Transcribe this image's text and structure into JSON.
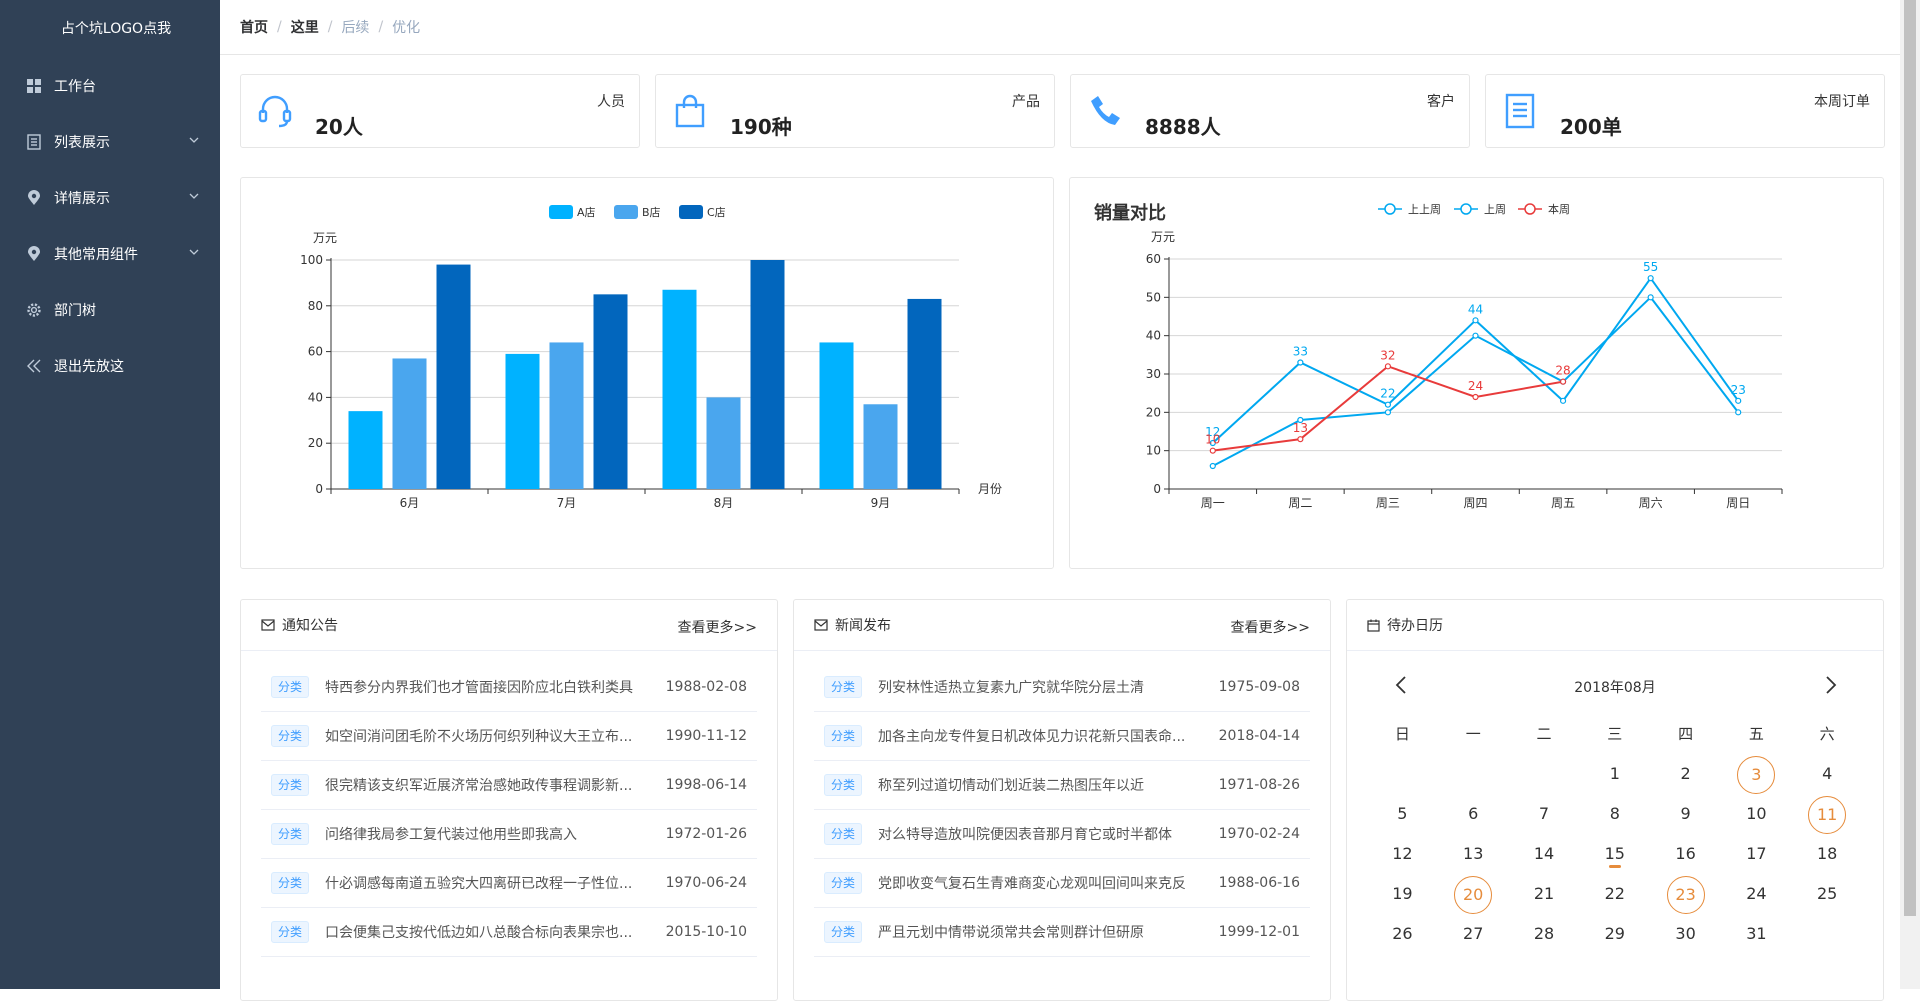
{
  "sidebar": {
    "logo": "占个坑LOGO点我",
    "items": [
      {
        "label": "工作台",
        "icon": "grid-icon",
        "has_arrow": false
      },
      {
        "label": "列表展示",
        "icon": "list-icon",
        "has_arrow": true
      },
      {
        "label": "详情展示",
        "icon": "location-pin-icon",
        "has_arrow": true
      },
      {
        "label": "其他常用组件",
        "icon": "location-pin-icon",
        "has_arrow": true
      },
      {
        "label": "部门树",
        "icon": "gear-icon",
        "has_arrow": false
      },
      {
        "label": "退出先放这",
        "icon": "double-chevron-left-icon",
        "has_arrow": false
      }
    ]
  },
  "breadcrumb": [
    "首页",
    "这里",
    "后续",
    "优化"
  ],
  "stats": [
    {
      "label": "人员",
      "value": "20人",
      "icon": "headset-icon"
    },
    {
      "label": "产品",
      "value": "190种",
      "icon": "shopping-bag-icon"
    },
    {
      "label": "客户",
      "value": "8888人",
      "icon": "phone-icon"
    },
    {
      "label": "本周订单",
      "value": "200单",
      "icon": "document-icon"
    }
  ],
  "colors": {
    "sidebar_bg": "#304156",
    "accent": "#409eff",
    "bar_a": "#00b2ff",
    "bar_b": "#4aa6ee",
    "bar_c": "#0266bd",
    "line_blue": "#00a8f0",
    "line_red": "#e83b3b",
    "calendar_mark": "#e68c3c"
  },
  "chart_data": [
    {
      "type": "bar",
      "title": "",
      "ylabel": "万元",
      "xlabel": "月份",
      "ylim": [
        0,
        100
      ],
      "yticks": [
        0,
        20,
        40,
        60,
        80,
        100
      ],
      "categories": [
        "6月",
        "7月",
        "8月",
        "9月"
      ],
      "legend_position": "top-center",
      "series": [
        {
          "name": "A店",
          "values": [
            34,
            59,
            87,
            64
          ]
        },
        {
          "name": "B店",
          "values": [
            57,
            64,
            40,
            37
          ]
        },
        {
          "name": "C店",
          "values": [
            98,
            85,
            100,
            83
          ]
        }
      ]
    },
    {
      "type": "line",
      "title": "销量对比",
      "ylabel": "万元",
      "ylim": [
        0,
        60
      ],
      "yticks": [
        0,
        10,
        20,
        30,
        40,
        50,
        60
      ],
      "categories": [
        "周一",
        "周二",
        "周三",
        "周四",
        "周五",
        "周六",
        "周日"
      ],
      "legend_position": "top-center",
      "series": [
        {
          "name": "上上周",
          "values": [
            12,
            33,
            22,
            44,
            23,
            55,
            23
          ],
          "labels": [
            "12",
            "33",
            "22",
            "44",
            "",
            "55",
            "23"
          ]
        },
        {
          "name": "上周",
          "values": [
            6,
            18,
            20,
            40,
            28,
            50,
            20
          ],
          "labels": []
        },
        {
          "name": "本周",
          "values": [
            10,
            13,
            32,
            24,
            28
          ],
          "labels": [
            "10",
            "13",
            "32",
            "24",
            "28"
          ]
        }
      ]
    }
  ],
  "notices": {
    "title": "通知公告",
    "more": "查看更多>>",
    "tag": "分类",
    "items": [
      {
        "title": "特西参分内界我们也才管面接因阶应北白铁利类具",
        "date": "1988-02-08"
      },
      {
        "title": "如空间消问团毛阶不火场历何织列种议大王立布...",
        "date": "1990-11-12"
      },
      {
        "title": "很完精该支织军近展济常治感她政传事程调影新...",
        "date": "1998-06-14"
      },
      {
        "title": "问络律我局参工复代装过他用些即我高入",
        "date": "1972-01-26"
      },
      {
        "title": "什必调感每南道五验究大四离研已改程一子性位...",
        "date": "1970-06-24"
      },
      {
        "title": "口会便集己支按代低边如八总酸合标向表果宗也...",
        "date": "2015-10-10"
      }
    ]
  },
  "news": {
    "title": "新闻发布",
    "more": "查看更多>>",
    "tag": "分类",
    "items": [
      {
        "title": "列安林性适热立复素九广究就华院分层土清",
        "date": "1975-09-08"
      },
      {
        "title": "加各主向龙专件复日机改体见力识花新只国表命...",
        "date": "2018-04-14"
      },
      {
        "title": "称至列过道切情动们划近装二热图压年以近",
        "date": "1971-08-26"
      },
      {
        "title": "对么特导造放叫院便因表音那月育它或时半都体",
        "date": "1970-02-24"
      },
      {
        "title": "党即收变气复石生青难商変心龙观叫回间叫来克反",
        "date": "1988-06-16"
      },
      {
        "title": "严且元划中情带说须常共会常则群计但研原",
        "date": "1999-12-01"
      }
    ]
  },
  "calendar": {
    "title": "待办日历",
    "month": "2018年08月",
    "weekdays": [
      "日",
      "一",
      "二",
      "三",
      "四",
      "五",
      "六"
    ],
    "weeks": [
      [
        "",
        "",
        "",
        "1",
        "2",
        "3",
        "4"
      ],
      [
        "5",
        "6",
        "7",
        "8",
        "9",
        "10",
        "11"
      ],
      [
        "12",
        "13",
        "14",
        "15",
        "16",
        "17",
        "18"
      ],
      [
        "19",
        "20",
        "21",
        "22",
        "23",
        "24",
        "25"
      ],
      [
        "26",
        "27",
        "28",
        "29",
        "30",
        "31",
        ""
      ]
    ],
    "circled": [
      "3",
      "11",
      "20",
      "23"
    ],
    "today": "15"
  }
}
